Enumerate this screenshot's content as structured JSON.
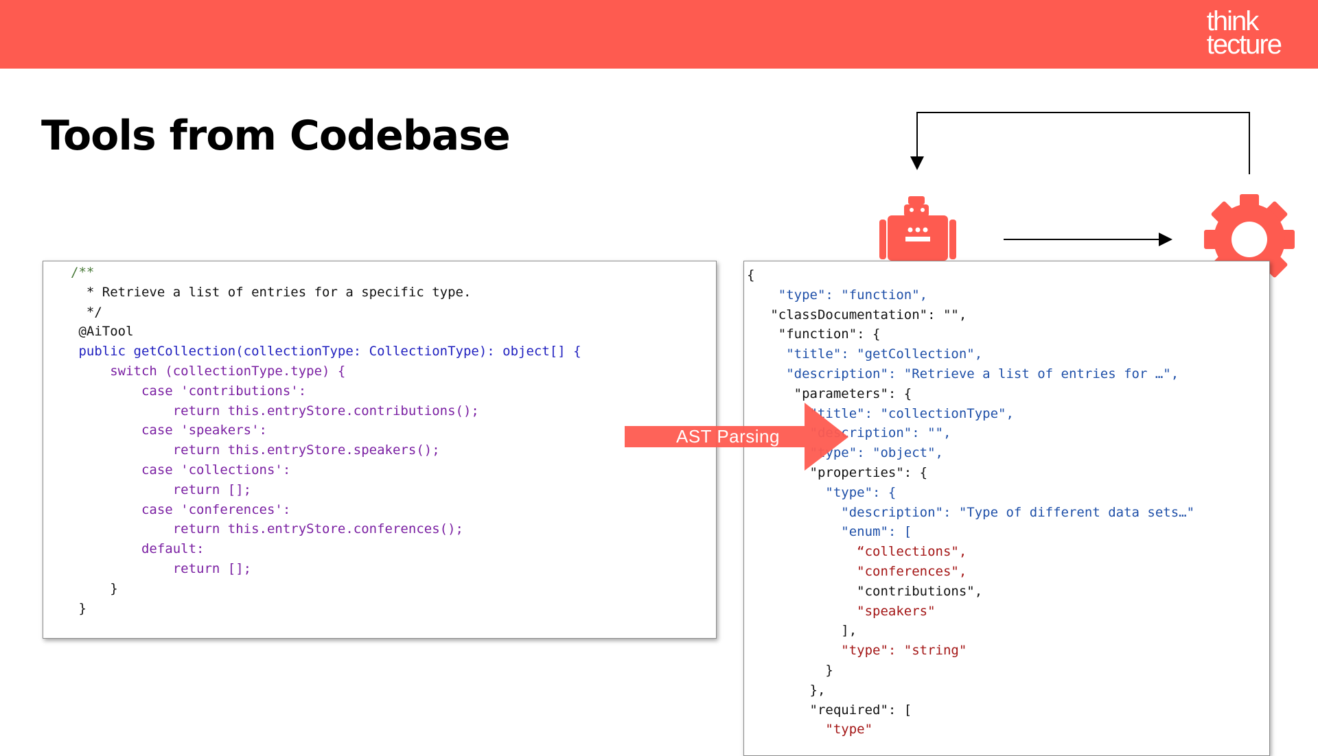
{
  "header": {
    "logo_line1": "think",
    "logo_line2": "tecture",
    "color": "#fe5b50"
  },
  "title": "Tools from Codebase",
  "arrow_label": "AST Parsing",
  "icons": {
    "robot": "robot-icon",
    "gear": "gear-icon"
  },
  "left_code": [
    "/**",
    "  * Retrieve a list of entries for a specific type.",
    "  */",
    " @AiTool",
    " public getCollection(collectionType: CollectionType): object[] {",
    "     switch (collectionType.type) {",
    "         case 'contributions':",
    "             return this.entryStore.contributions();",
    "         case 'speakers':",
    "             return this.entryStore.speakers();",
    "         case 'collections':",
    "             return [];",
    "         case 'conferences':",
    "             return this.entryStore.conferences();",
    "         default:",
    "             return [];",
    "     }",
    " }"
  ],
  "right_code": [
    "{",
    "    \"type\": \"function\",",
    "   \"classDocumentation\": \"\",",
    "    \"function\": {",
    "     \"title\": \"getCollection\",",
    "     \"description\": \"Retrieve a list of entries for …\",",
    "      \"parameters\": {",
    "        \"title\": \"collectionType\",",
    "        \"description\": \"\",",
    "        \"type\": \"object\",",
    "        \"properties\": {",
    "          \"type\": {",
    "            \"description\": \"Type of different data sets…\"",
    "            \"enum\": [",
    "              “collections\",",
    "              \"conferences\",",
    "              \"contributions\",",
    "              \"speakers\"",
    "            ],",
    "            \"type\": \"string\"",
    "          }",
    "        },",
    "        \"required\": [",
    "          \"type\""
  ]
}
